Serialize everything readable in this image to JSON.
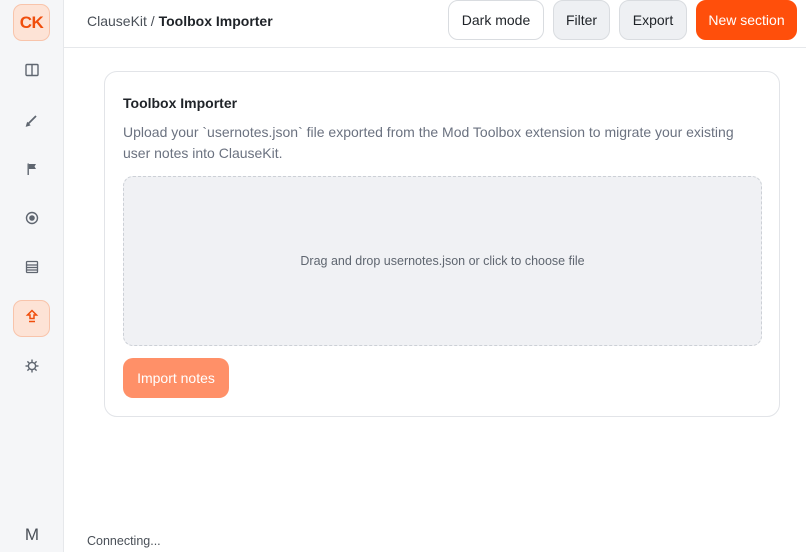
{
  "app": {
    "logo_text": "CK",
    "accent_color": "#ff4f0b"
  },
  "sidebar": {
    "items": [
      {
        "icon": "columns-icon",
        "active": false
      },
      {
        "icon": "pencil-icon",
        "active": false
      },
      {
        "icon": "flag-icon",
        "active": false
      },
      {
        "icon": "target-icon",
        "active": false
      },
      {
        "icon": "list-icon",
        "active": false
      },
      {
        "icon": "upload-icon",
        "active": true
      },
      {
        "icon": "gear-icon",
        "active": false
      }
    ],
    "user_initial": "M"
  },
  "header": {
    "breadcrumb_root": "ClauseKit / ",
    "breadcrumb_current": "Toolbox Importer",
    "buttons": {
      "dark_mode": "Dark mode",
      "filter": "Filter",
      "export": "Export",
      "new_section": "New section"
    }
  },
  "importer": {
    "title": "Toolbox Importer",
    "description": "Upload your `usernotes.json` file exported from the Mod Toolbox extension to migrate your existing user notes into ClauseKit.",
    "dropzone_text": "Drag and drop usernotes.json or click to choose file",
    "import_button": "Import notes"
  },
  "status": {
    "text": "Connecting..."
  }
}
